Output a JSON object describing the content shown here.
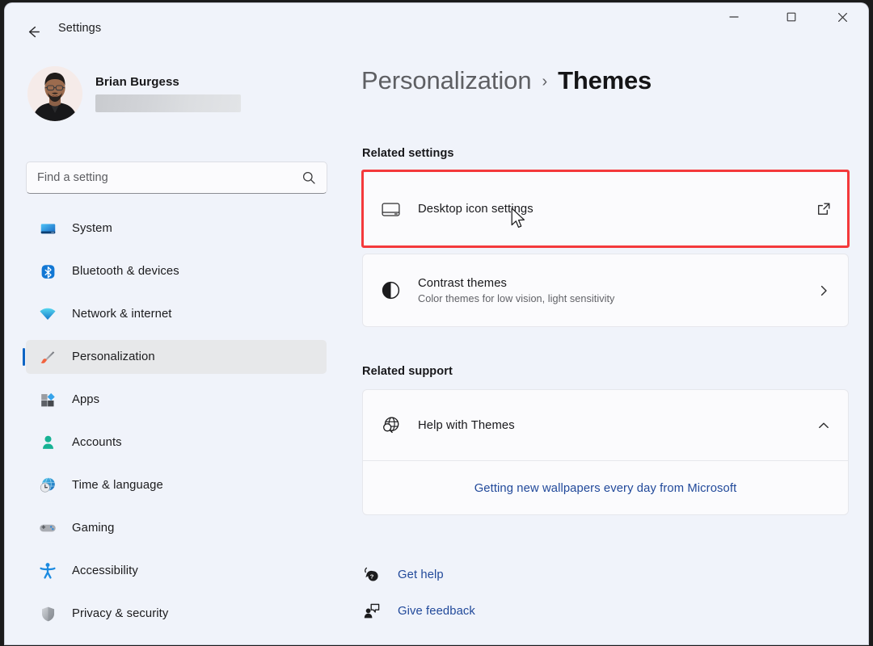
{
  "window": {
    "title": "Settings",
    "back_icon": "arrow-left-icon",
    "controls": {
      "minimize": "minimize-icon",
      "maximize": "maximize-icon",
      "close": "close-icon"
    }
  },
  "profile": {
    "name": "Brian Burgess",
    "email_redacted": true,
    "avatar": "user-avatar-photo"
  },
  "search": {
    "placeholder": "Find a setting",
    "icon": "search-icon"
  },
  "sidebar": {
    "items": [
      {
        "label": "System",
        "icon": "monitor-icon",
        "selected": false
      },
      {
        "label": "Bluetooth & devices",
        "icon": "bluetooth-icon",
        "selected": false
      },
      {
        "label": "Network & internet",
        "icon": "wifi-icon",
        "selected": false
      },
      {
        "label": "Personalization",
        "icon": "paintbrush-icon",
        "selected": true
      },
      {
        "label": "Apps",
        "icon": "apps-blocks-icon",
        "selected": false
      },
      {
        "label": "Accounts",
        "icon": "person-icon",
        "selected": false
      },
      {
        "label": "Time & language",
        "icon": "clock-globe-icon",
        "selected": false
      },
      {
        "label": "Gaming",
        "icon": "gamepad-icon",
        "selected": false
      },
      {
        "label": "Accessibility",
        "icon": "accessibility-person-icon",
        "selected": false
      },
      {
        "label": "Privacy & security",
        "icon": "shield-icon",
        "selected": false
      }
    ]
  },
  "main": {
    "breadcrumb": {
      "parent": "Personalization",
      "separator": "›",
      "current": "Themes"
    },
    "related_settings": {
      "heading": "Related settings",
      "items": [
        {
          "title": "Desktop icon settings",
          "subtitle": "",
          "icon": "desktop-icon",
          "trailing_icon": "external-link-icon",
          "highlighted": true
        },
        {
          "title": "Contrast themes",
          "subtitle": "Color themes for low vision, light sensitivity",
          "icon": "contrast-circle-icon",
          "trailing_icon": "chevron-right-icon",
          "highlighted": false
        }
      ]
    },
    "related_support": {
      "heading": "Related support",
      "card_title": "Help with Themes",
      "card_icon": "globe-search-icon",
      "card_trailing_icon": "chevron-up-icon",
      "expanded_link": "Getting new wallpapers every day from Microsoft"
    },
    "footer_links": [
      {
        "label": "Get help",
        "icon": "help-bubble-icon"
      },
      {
        "label": "Give feedback",
        "icon": "feedback-person-icon"
      }
    ]
  },
  "colors": {
    "page_background": "#f0f3fa",
    "card_background": "#fbfbfd",
    "accent_blue": "#0f65c4",
    "link_blue": "#21499a",
    "highlight_red": "#f4393b",
    "selected_nav": "#e7e8ea"
  },
  "cursor": {
    "icon": "mouse-pointer-icon"
  }
}
